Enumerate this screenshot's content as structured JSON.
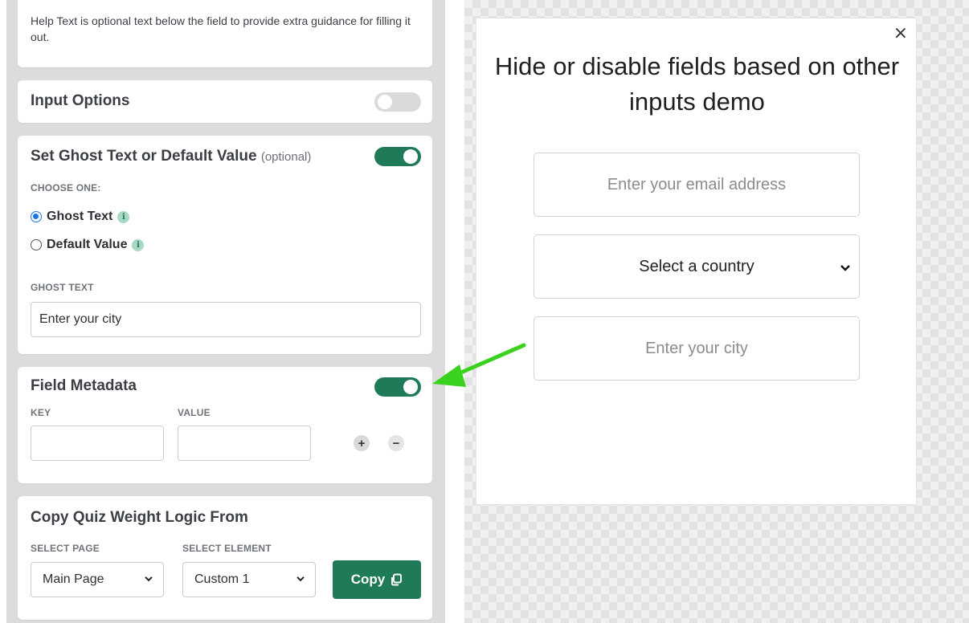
{
  "help_card": {
    "text": "Help Text is optional text below the field to provide extra guidance for filling it out."
  },
  "input_options": {
    "title": "Input Options",
    "toggle_state": "off"
  },
  "ghost_section": {
    "title": "Set Ghost Text or Default Value",
    "optional": "(optional)",
    "toggle_state": "on",
    "choose_label": "CHOOSE ONE:",
    "options": [
      {
        "label": "Ghost Text",
        "checked": true
      },
      {
        "label": "Default Value",
        "checked": false
      }
    ],
    "info_glyph": "i",
    "ghost_label": "GHOST TEXT",
    "ghost_value": "Enter your city"
  },
  "metadata": {
    "title": "Field Metadata",
    "toggle_state": "on",
    "key_label": "KEY",
    "value_label": "VALUE",
    "key_value": "",
    "value_value": "",
    "add_glyph": "+",
    "remove_glyph": "−"
  },
  "copy_logic": {
    "title": "Copy Quiz Weight Logic From",
    "page_label": "SELECT PAGE",
    "element_label": "SELECT ELEMENT",
    "page_selected": "Main Page",
    "element_selected": "Custom 1",
    "copy_label": "Copy"
  },
  "preview": {
    "close_glyph": "×",
    "title": "Hide or disable fields based on other inputs demo",
    "email_placeholder": "Enter your email address",
    "country_selected": "Select a country",
    "city_placeholder": "Enter your city"
  },
  "colors": {
    "accent": "#1e7a57",
    "arrow": "#3ad11f",
    "radio": "#1a73e8"
  }
}
